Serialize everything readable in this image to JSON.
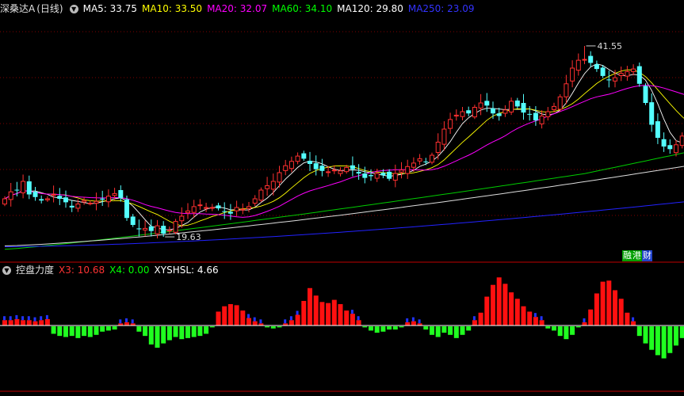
{
  "main": {
    "title": "深桑达A",
    "period": "(日线)",
    "collapse_icon": "chevron-down-icon",
    "ma": [
      {
        "label": "MA5: 33.75",
        "color": "#ffffff"
      },
      {
        "label": "MA10: 33.50",
        "color": "#ffff00"
      },
      {
        "label": "MA20: 32.07",
        "color": "#ff00ff"
      },
      {
        "label": "MA60: 34.10",
        "color": "#00ff00"
      },
      {
        "label": "MA120: 29.80",
        "color": "#ffffff"
      },
      {
        "label": "MA250: 23.09",
        "color": "#3333ff"
      }
    ],
    "high_marker": "41.55",
    "low_marker": "19.63",
    "badges": [
      "融",
      "港",
      "财"
    ]
  },
  "sub": {
    "title": "控盘力度",
    "lines": [
      {
        "label": "X3: 10.68",
        "color": "#ff3333"
      },
      {
        "label": "X4: 0.00",
        "color": "#00ff00"
      },
      {
        "label": "XYSHSL: 4.66",
        "color": "#ffffff"
      }
    ]
  },
  "chart_data": [
    {
      "type": "candlestick",
      "title": "深桑达A (日线)",
      "price_range": [
        17,
        45
      ],
      "high": 41.55,
      "low": 19.63,
      "closes": [
        24,
        24.8,
        25,
        26,
        24.5,
        24.2,
        23.8,
        24,
        24.5,
        24,
        23.6,
        23,
        23.4,
        23.8,
        23.5,
        23.7,
        23.9,
        24.3,
        24.6,
        24.1,
        21.8,
        21,
        20.5,
        20.6,
        20.3,
        20.9,
        20,
        20.4,
        21.4,
        22,
        22.6,
        23.1,
        23.3,
        23,
        23,
        22.9,
        22.5,
        22.3,
        23,
        22.8,
        23.1,
        24,
        25,
        25.5,
        26,
        27,
        27.8,
        28.3,
        28.9,
        28.6,
        28,
        27.4,
        27.2,
        27.1,
        27.3,
        27.2,
        27.6,
        27.4,
        26.9,
        26.4,
        26.6,
        26.9,
        26.7,
        26.3,
        26.9,
        27.3,
        27.7,
        28.1,
        28.6,
        28.2,
        29,
        30.5,
        32,
        33.1,
        33.6,
        34,
        33.8,
        34.5,
        35,
        34.7,
        33.8,
        33.5,
        34.2,
        35.2,
        34.6,
        33.9,
        33.7,
        33,
        33.5,
        34,
        34.6,
        35.7,
        37.2,
        39,
        39.9,
        40,
        39.6,
        38.9,
        38.1,
        37.6,
        37.9,
        38.4,
        38.6,
        38.9,
        37.2,
        35,
        32.5,
        31,
        30,
        29.7,
        30.2,
        31.2,
        32.5
      ],
      "moving_averages": [
        "MA5",
        "MA10",
        "MA20",
        "MA60",
        "MA120",
        "MA250"
      ]
    },
    {
      "type": "bar",
      "title": "控盘力度",
      "values": [
        5,
        5,
        6,
        5,
        5,
        4,
        5,
        6,
        -7,
        -9,
        -10,
        -9,
        -11,
        -9,
        -10,
        -8,
        -5,
        -4,
        -3,
        2,
        3,
        2,
        -5,
        -9,
        -17,
        -20,
        -16,
        -13,
        -10,
        -12,
        -11,
        -10,
        -9,
        -7,
        -1,
        13,
        18,
        20,
        19,
        14,
        7,
        4,
        2,
        -1,
        -2,
        -1,
        2,
        5,
        10,
        23,
        35,
        28,
        22,
        21,
        24,
        20,
        14,
        11,
        5,
        -1,
        -4,
        -6,
        -5,
        -3,
        -3,
        -1,
        3,
        4,
        2,
        -3,
        -8,
        -10,
        -6,
        -8,
        -11,
        -8,
        -4,
        5,
        12,
        27,
        38,
        45,
        39,
        31,
        25,
        18,
        13,
        8,
        5,
        -2,
        -4,
        -9,
        -12,
        -8,
        -1,
        3,
        15,
        30,
        41,
        42,
        33,
        25,
        12,
        4,
        -9,
        -16,
        -22,
        -27,
        -30,
        -25,
        -18,
        -11,
        -6,
        -3
      ]
    }
  ]
}
